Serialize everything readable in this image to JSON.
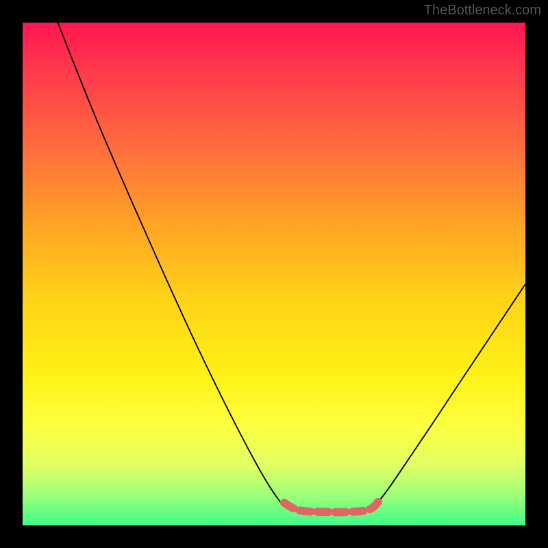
{
  "attribution": "TheBottleneck.com",
  "chart_data": {
    "type": "line",
    "title": "",
    "xlabel": "",
    "ylabel": "",
    "xlim": [
      0,
      100
    ],
    "ylim": [
      0,
      100
    ],
    "series": [
      {
        "name": "curve",
        "points": [
          {
            "x": 7,
            "y": 100
          },
          {
            "x": 15,
            "y": 80
          },
          {
            "x": 25,
            "y": 57
          },
          {
            "x": 35,
            "y": 35
          },
          {
            "x": 45,
            "y": 15
          },
          {
            "x": 51,
            "y": 5
          },
          {
            "x": 54,
            "y": 3
          },
          {
            "x": 58,
            "y": 2.5
          },
          {
            "x": 63,
            "y": 2.5
          },
          {
            "x": 68,
            "y": 3
          },
          {
            "x": 71,
            "y": 5
          },
          {
            "x": 78,
            "y": 15
          },
          {
            "x": 88,
            "y": 30
          },
          {
            "x": 100,
            "y": 48
          }
        ]
      },
      {
        "name": "bottom-marker",
        "points": [
          {
            "x": 52,
            "y": 4.5
          },
          {
            "x": 55,
            "y": 3
          },
          {
            "x": 60,
            "y": 2.7
          },
          {
            "x": 65,
            "y": 2.7
          },
          {
            "x": 69,
            "y": 3.2
          },
          {
            "x": 71,
            "y": 5
          }
        ]
      }
    ],
    "gradient_colors": [
      "#ff1750",
      "#ffa324",
      "#fff115",
      "#3dff87"
    ]
  }
}
